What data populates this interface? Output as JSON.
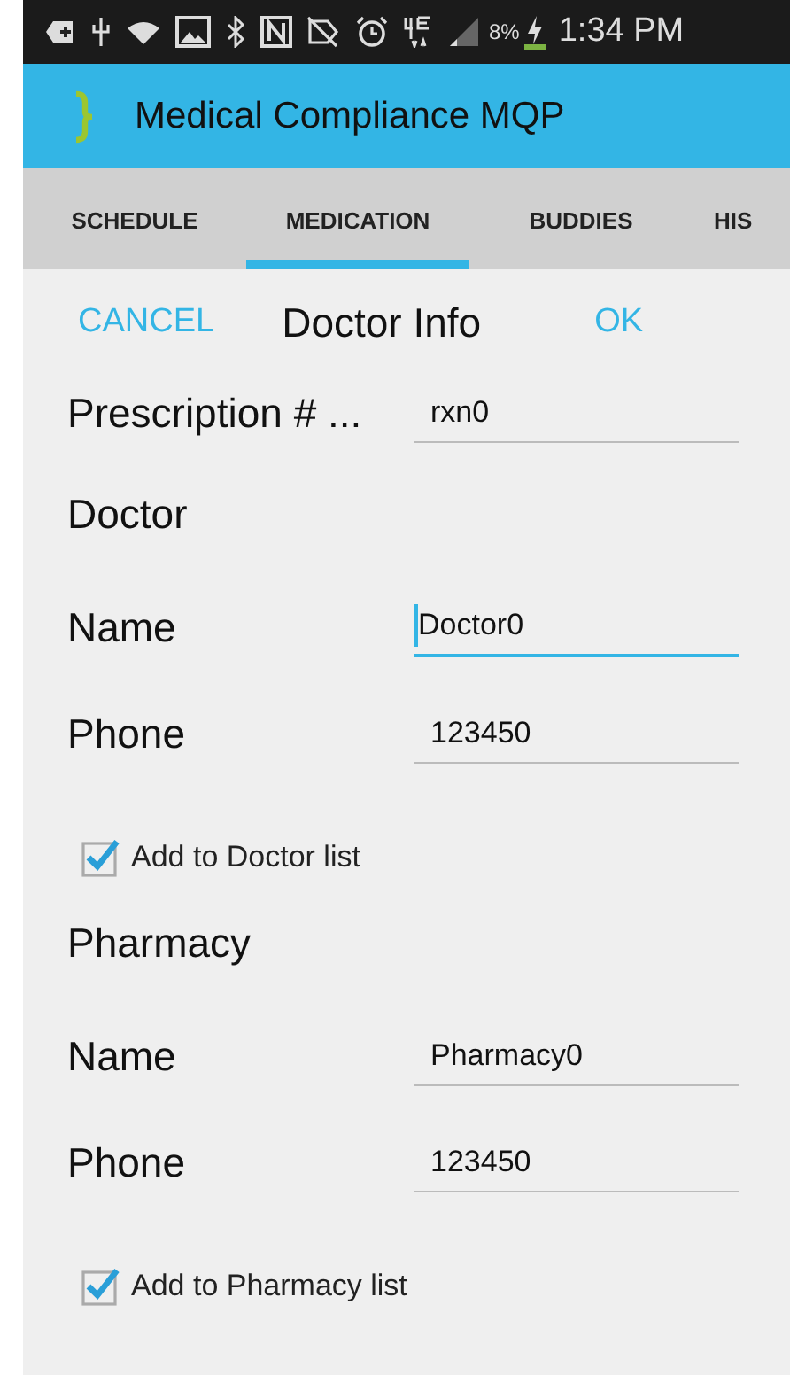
{
  "status_bar": {
    "battery": "8%",
    "time": "1:34 PM"
  },
  "app_bar": {
    "title": "Medical Compliance MQP"
  },
  "tabs": [
    {
      "label": "SCHEDULE",
      "selected": false
    },
    {
      "label": "MEDICATION",
      "selected": true
    },
    {
      "label": "BUDDIES",
      "selected": false
    },
    {
      "label": "HIS",
      "selected": false
    }
  ],
  "dialog": {
    "cancel": "CANCEL",
    "title": "Doctor Info",
    "ok": "OK"
  },
  "prescription": {
    "label": "Prescription # ...",
    "value": "rxn0",
    "focused": false
  },
  "sections": [
    {
      "title": "Doctor",
      "fields": [
        {
          "label": "Name",
          "value": "Doctor0",
          "focused": true
        },
        {
          "label": "Phone",
          "value": "123450",
          "focused": false
        }
      ],
      "checkbox": {
        "label": "Add to Doctor list",
        "checked": true
      }
    },
    {
      "title": "Pharmacy",
      "fields": [
        {
          "label": "Name",
          "value": "Pharmacy0",
          "focused": false
        },
        {
          "label": "Phone",
          "value": "123450",
          "focused": false
        }
      ],
      "checkbox": {
        "label": "Add to Pharmacy list",
        "checked": true
      }
    }
  ]
}
